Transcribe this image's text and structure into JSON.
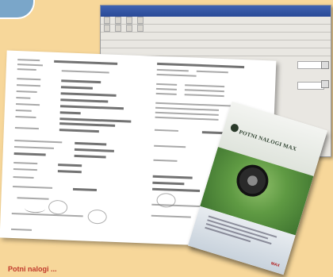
{
  "window": {
    "title": "",
    "toolbar": [
      "",
      "",
      "",
      ""
    ]
  },
  "book": {
    "title": "POTNI NALOGI MAX",
    "brand": "MAX"
  },
  "caption": "Potni nalogi ..."
}
